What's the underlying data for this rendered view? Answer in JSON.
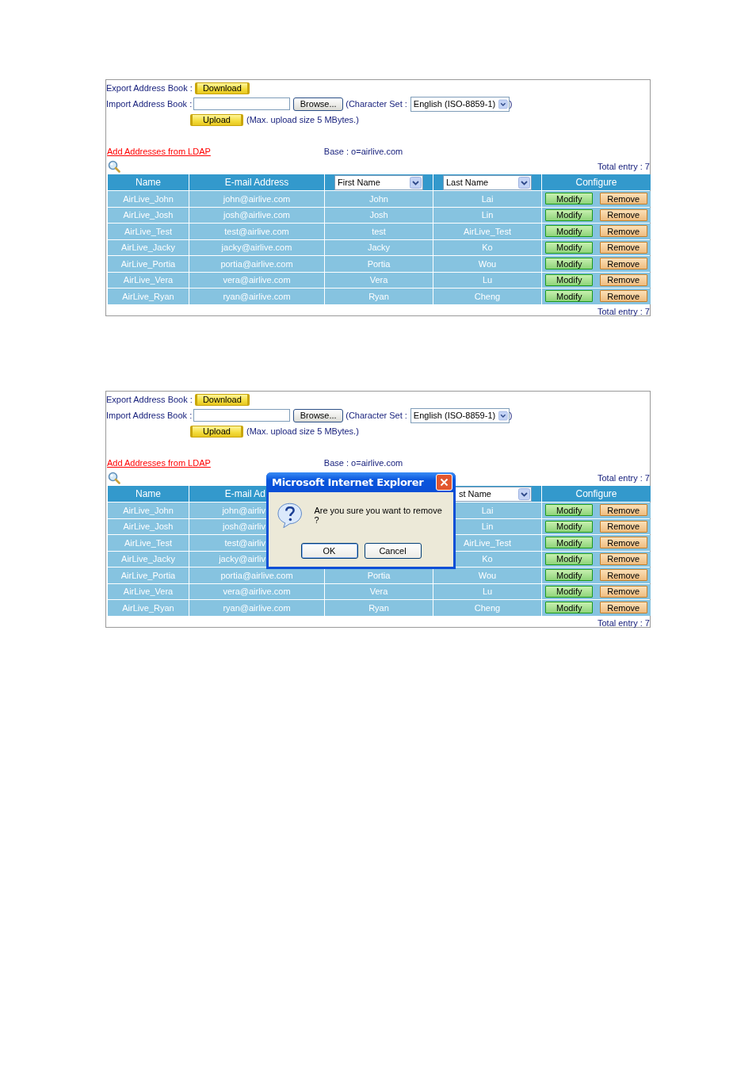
{
  "panels": [
    {
      "export_label": "Export Address Book :",
      "download_button": "Download",
      "import_label": "Import Address Book :",
      "browse_button": "Browse...",
      "charset_label": "(Character Set :",
      "charset_select": "English (ISO-8859-1)",
      "charset_close": ")",
      "upload_button": "Upload",
      "upload_note": "(Max. upload size 5 MBytes.)",
      "ldap_link": "Add Addresses from LDAP",
      "base": "Base : o=airlive.com",
      "total_top": "Total entry : 7",
      "table": {
        "columns": [
          {
            "kind": "label",
            "text": "Name"
          },
          {
            "kind": "label",
            "text": "E-mail Address"
          },
          {
            "kind": "select",
            "text": "First Name"
          },
          {
            "kind": "select",
            "text": "Last Name"
          },
          {
            "kind": "label",
            "text": "Configure"
          }
        ],
        "rows": [
          {
            "cells": [
              "AirLive_John",
              "john@airlive.com",
              "John",
              "Lai"
            ],
            "actions": [
              "Modify",
              "Remove"
            ]
          },
          {
            "cells": [
              "AirLive_Josh",
              "josh@airlive.com",
              "Josh",
              "Lin"
            ],
            "actions": [
              "Modify",
              "Remove"
            ]
          },
          {
            "cells": [
              "AirLive_Test",
              "test@airlive.com",
              "test",
              "AirLive_Test"
            ],
            "actions": [
              "Modify",
              "Remove"
            ]
          },
          {
            "cells": [
              "AirLive_Jacky",
              "jacky@airlive.com",
              "Jacky",
              "Ko"
            ],
            "actions": [
              "Modify",
              "Remove"
            ]
          },
          {
            "cells": [
              "AirLive_Portia",
              "portia@airlive.com",
              "Portia",
              "Wou"
            ],
            "actions": [
              "Modify",
              "Remove"
            ]
          },
          {
            "cells": [
              "AirLive_Vera",
              "vera@airlive.com",
              "Vera",
              "Lu"
            ],
            "actions": [
              "Modify",
              "Remove"
            ]
          },
          {
            "cells": [
              "AirLive_Ryan",
              "ryan@airlive.com",
              "Ryan",
              "Cheng"
            ],
            "actions": [
              "Modify",
              "Remove"
            ]
          }
        ]
      },
      "total_bottom": "Total entry : 7"
    },
    {
      "export_label": "Export Address Book :",
      "download_button": "Download",
      "import_label": "Import Address Book :",
      "browse_button": "Browse...",
      "charset_label": "(Character Set :",
      "charset_select": "English (ISO-8859-1)",
      "charset_close": ")",
      "upload_button": "Upload",
      "upload_note": "(Max. upload size 5 MBytes.)",
      "ldap_link": "Add Addresses from LDAP",
      "base": "Base : o=airlive.com",
      "total_top": "Total entry : 7",
      "table": {
        "columns": [
          {
            "kind": "label",
            "text": "Name"
          },
          {
            "kind": "label",
            "text": "E-mail Ad"
          },
          null,
          {
            "kind": "select",
            "text": "st Name"
          },
          {
            "kind": "label",
            "text": "Configure"
          }
        ],
        "rows": [
          {
            "cells": [
              "AirLive_John",
              "john@airliv",
              null,
              "Lai"
            ],
            "actions": [
              "Modify",
              "Remove"
            ]
          },
          {
            "cells": [
              "AirLive_Josh",
              "josh@airliv",
              null,
              "Lin"
            ],
            "actions": [
              "Modify",
              "Remove"
            ]
          },
          {
            "cells": [
              "AirLive_Test",
              "test@airliv",
              null,
              "AirLive_Test"
            ],
            "actions": [
              "Modify",
              "Remove"
            ]
          },
          {
            "cells": [
              "AirLive_Jacky",
              "jacky@airliv",
              null,
              "Ko"
            ],
            "actions": [
              "Modify",
              "Remove"
            ]
          },
          {
            "cells": [
              "AirLive_Portia",
              "portia@airlive.com",
              "Portia",
              "Wou"
            ],
            "actions": [
              "Modify",
              "Remove"
            ]
          },
          {
            "cells": [
              "AirLive_Vera",
              "vera@airlive.com",
              "Vera",
              "Lu"
            ],
            "actions": [
              "Modify",
              "Remove"
            ]
          },
          {
            "cells": [
              "AirLive_Ryan",
              "ryan@airlive.com",
              "Ryan",
              "Cheng"
            ],
            "actions": [
              "Modify",
              "Remove"
            ]
          }
        ]
      },
      "total_bottom": "Total entry : 7",
      "dialog": {
        "title": "Microsoft Internet Explorer",
        "message": "Are you sure you want to remove ?",
        "buttons": [
          "OK",
          "Cancel"
        ]
      }
    }
  ]
}
